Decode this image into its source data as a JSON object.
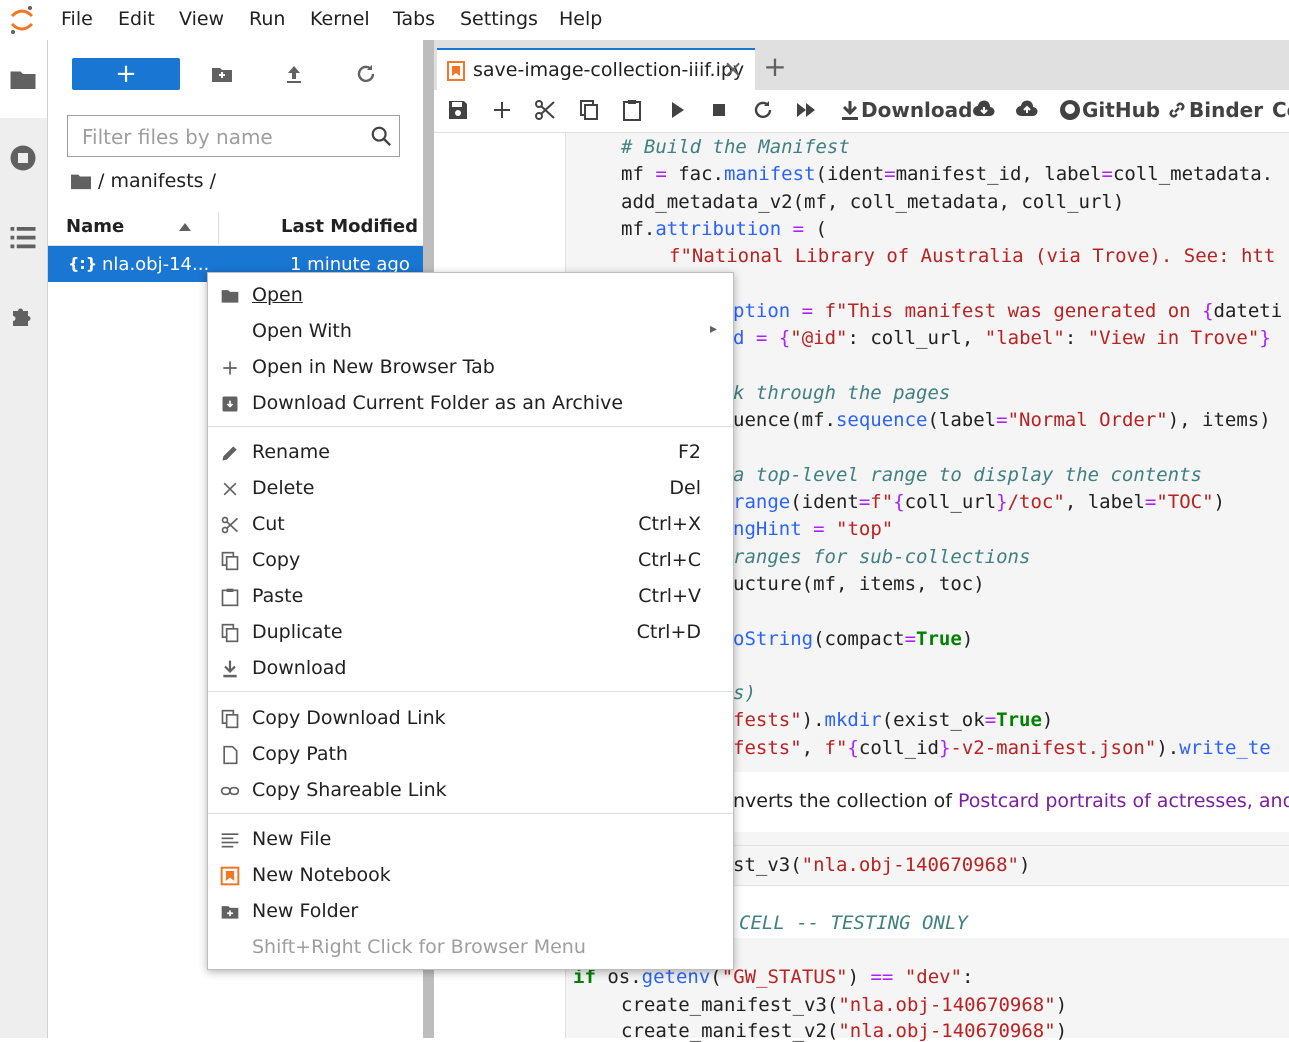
{
  "menubar": {
    "items": [
      "File",
      "Edit",
      "View",
      "Run",
      "Kernel",
      "Tabs",
      "Settings",
      "Help"
    ]
  },
  "filebrowser": {
    "new_label": "+",
    "filter_placeholder": "Filter files by name",
    "breadcrumb": "/ manifests /",
    "col_name": "Name",
    "col_modified": "Last Modified",
    "file": {
      "icon": "{:}",
      "name": "nla.obj-14...",
      "modified": "1 minute ago"
    }
  },
  "notebook": {
    "tab_title": "save-image-collection-iiif.ipy",
    "toolbar": {
      "download": "Download",
      "github": "GitHub",
      "binder": "Binder",
      "more": "Co"
    },
    "md_text_prefix": "nverts the collection of ",
    "md_link": "Postcard portraits of actresses, and",
    "section_comment": "CELL -- TESTING ONLY"
  },
  "context_menu": {
    "items": [
      {
        "label": "Open",
        "shortcut": "",
        "icon": "folder-icon",
        "underline": 0
      },
      {
        "label": "Open With",
        "shortcut": "",
        "icon": "",
        "submenu": true
      },
      {
        "label": "Open in New Browser Tab",
        "shortcut": "",
        "icon": "plus-icon",
        "underline": 0
      },
      {
        "label": "Download Current Folder as an Archive",
        "shortcut": "",
        "icon": "archive-icon"
      },
      {
        "label": "Rename",
        "shortcut": "F2",
        "icon": "pencil-icon",
        "underline": 0
      },
      {
        "label": "Delete",
        "shortcut": "Del",
        "icon": "close-icon",
        "underline": 0
      },
      {
        "label": "Cut",
        "shortcut": "Ctrl+X",
        "icon": "scissors-icon"
      },
      {
        "label": "Copy",
        "shortcut": "Ctrl+C",
        "icon": "copy-icon",
        "underline": 0
      },
      {
        "label": "Paste",
        "shortcut": "Ctrl+V",
        "icon": "paste-icon",
        "underline": 0
      },
      {
        "label": "Duplicate",
        "shortcut": "Ctrl+D",
        "icon": "duplicate-icon"
      },
      {
        "label": "Download",
        "shortcut": "",
        "icon": "download-icon"
      },
      {
        "label": "Copy Download Link",
        "shortcut": "",
        "icon": "copy-icon",
        "underline": 0
      },
      {
        "label": "Copy Path",
        "shortcut": "",
        "icon": "file-icon"
      },
      {
        "label": "Copy Shareable Link",
        "shortcut": "",
        "icon": "link-icon"
      },
      {
        "label": "New File",
        "shortcut": "",
        "icon": "text-file-icon"
      },
      {
        "label": "New Notebook",
        "shortcut": "",
        "icon": "notebook-icon"
      },
      {
        "label": "New Folder",
        "shortcut": "",
        "icon": "new-folder-icon"
      }
    ],
    "hint": "Shift+Right Click for Browser Menu"
  },
  "colors": {
    "accent": "#1976d2",
    "jupyter_orange": "#f37726"
  }
}
